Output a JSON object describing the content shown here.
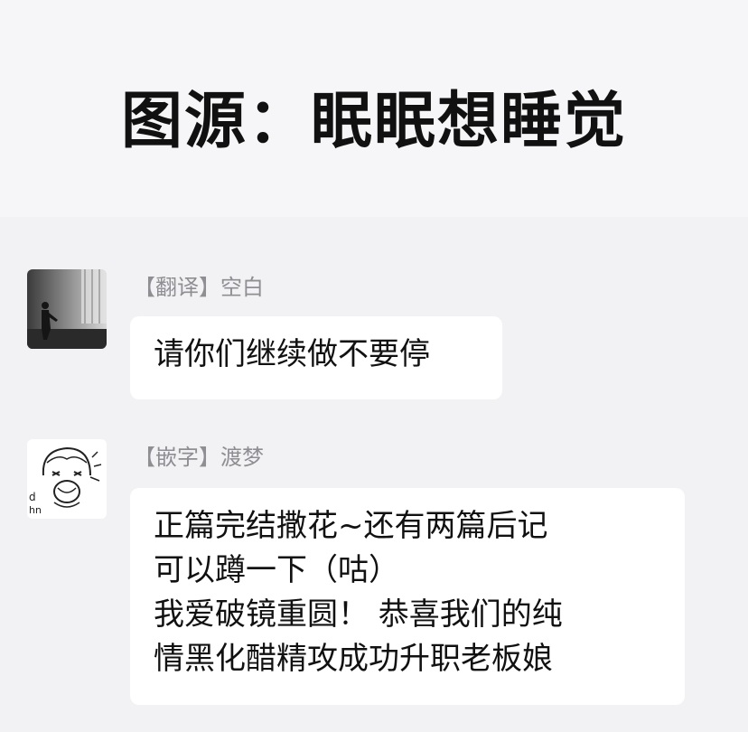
{
  "header": {
    "title": "图源：眠眠想睡觉"
  },
  "messages": [
    {
      "sender": "【翻译】空白",
      "avatar_icon": "person-standing-in-room-photo",
      "lines": [
        "请你们继续做不要停"
      ]
    },
    {
      "sender": "【嵌字】渡梦",
      "avatar_icon": "crying-anime-girl-sketch",
      "lines": [
        "正篇完结撒花~还有两篇后记",
        "可以蹲一下（咕）",
        "我爱破镜重圆！ 恭喜我们的纯",
        "情黑化醋精攻成功升职老板娘"
      ]
    }
  ]
}
